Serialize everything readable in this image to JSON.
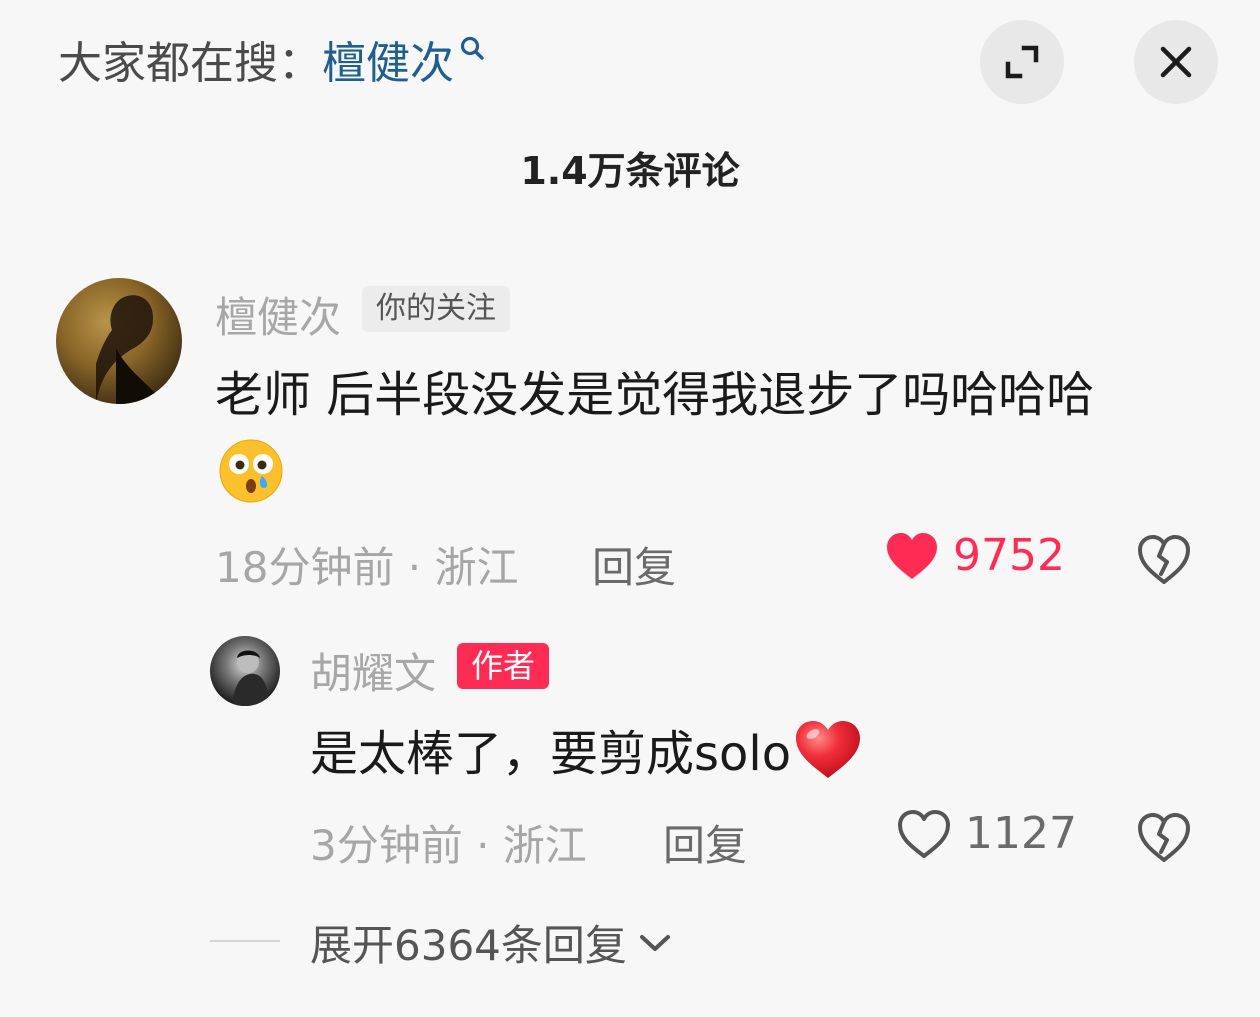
{
  "header": {
    "search_prefix": "大家都在搜：",
    "search_term": "檀健次",
    "expand_icon": "expand-icon",
    "close_icon": "close-icon"
  },
  "comment_count": "1.4万条评论",
  "comment": {
    "username": "檀健次",
    "tag": "你的关注",
    "text": "老师 后半段没发是觉得我退步了吗哈哈哈",
    "emoji": "astonished-tear-emoji",
    "time_location": "18分钟前 · 浙江",
    "reply_label": "回复",
    "likes": "9752",
    "liked": true
  },
  "reply": {
    "username": "胡耀文",
    "tag": "作者",
    "text": "是太棒了，要剪成solo",
    "emoji": "red-heart-emoji",
    "time_location": "3分钟前 · 浙江",
    "reply_label": "回复",
    "likes": "1127",
    "liked": false
  },
  "expand_replies": "展开6364条回复",
  "colors": {
    "accent_red": "#fe2c55",
    "search_term_blue": "#1f5f8f",
    "background": "#f7f7f7"
  }
}
